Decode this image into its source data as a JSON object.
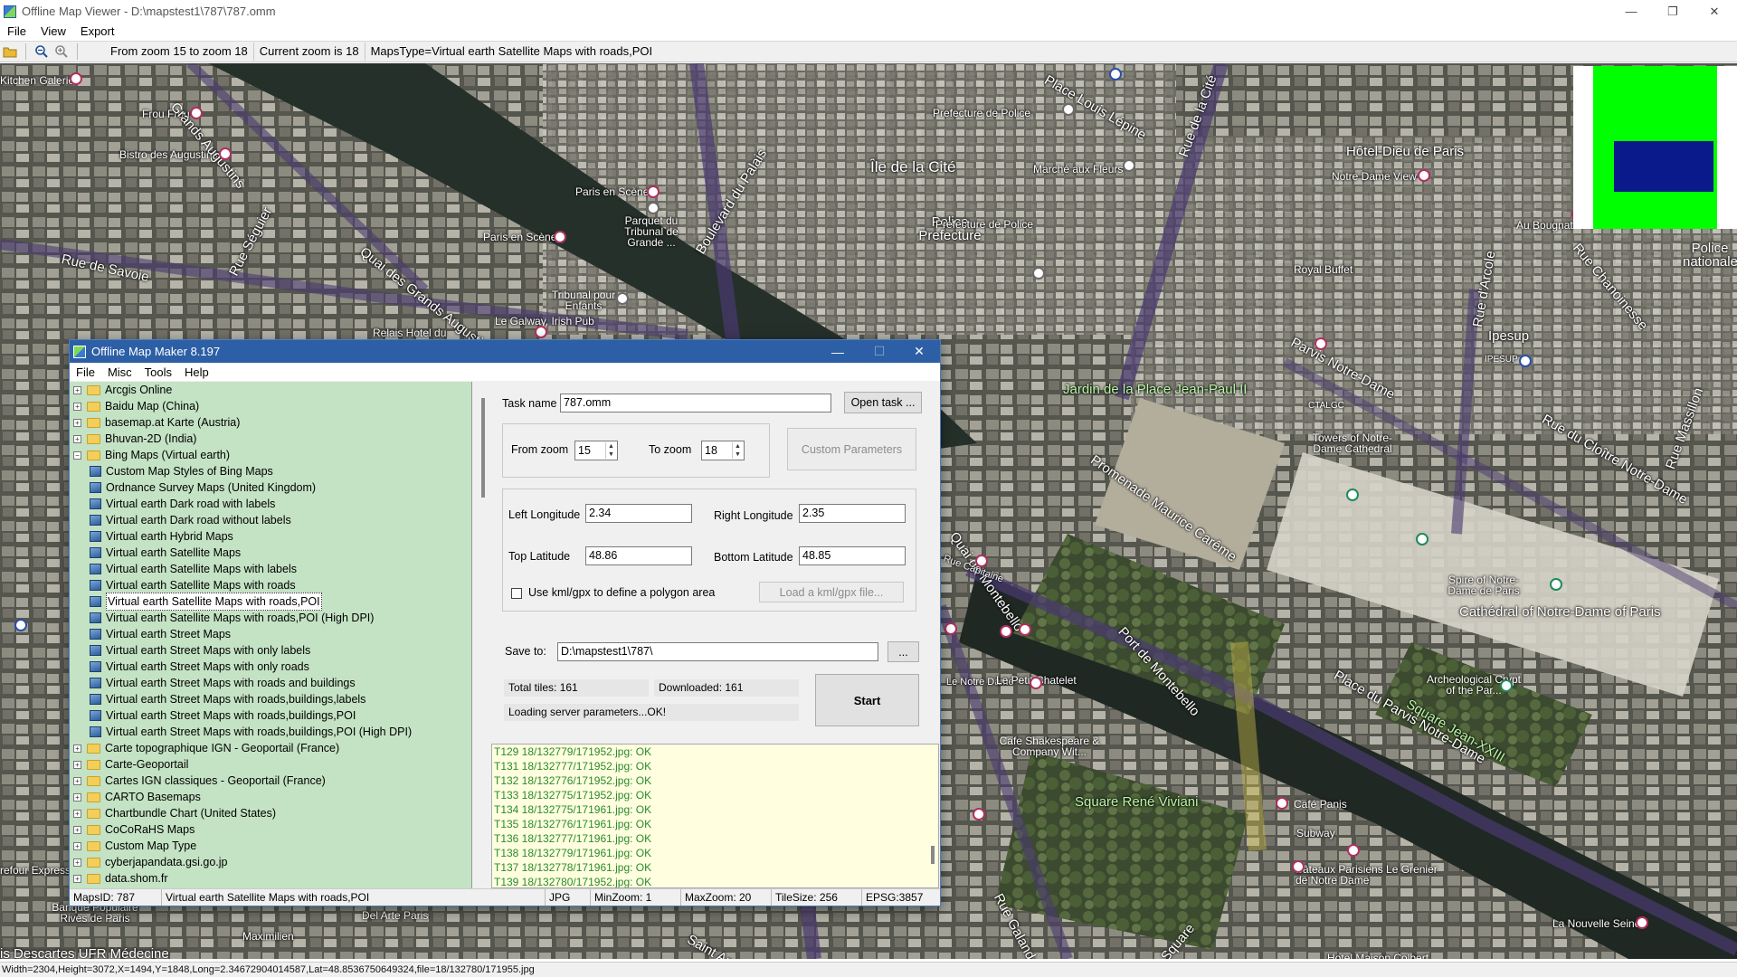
{
  "window": {
    "title": "Offline Map Viewer - D:\\mapstest1\\787\\787.omm",
    "minimize": "—",
    "maximize": "❐",
    "close": "✕"
  },
  "menu": [
    "File",
    "View",
    "Export"
  ],
  "toolbar": {
    "zoom_range": "From zoom 15 to zoom 18",
    "current_zoom": "Current zoom is 18",
    "maps_type": "MapsType=Virtual earth Satellite Maps with roads,POI"
  },
  "map_labels": {
    "grands_augustins": "Quai des Grands Augustins",
    "rue_grands_augustins": "Grands Augustins",
    "ile_de_la_cite": "Île de la Cité",
    "boulevard_du_palais": "Boulevard du Palais",
    "rue_de_la_cite": "Rue de la Cité",
    "hotel_dieu": "Hôtel-Dieu de Paris",
    "notre_dame_view": "Notre Dame View",
    "prefecture_police_1": "Prefecture de Police",
    "marche_aux_fleurs": "Marché aux Fleurs",
    "place_louis_lepine": "Place Louis Lépine",
    "police_prefecture": "Police Prefecture",
    "prefecture_police_2": "Prefecture de Police",
    "paris_en_scene_1": "Paris en Scène",
    "paris_en_scene_2": "Paris en Scène",
    "parquet_tribunal": "Parquet du Tribunal de Grande ...",
    "tribunal_enfants": "Tribunal pour Enfants",
    "le_galway": "Le Galway, Irish Pub",
    "relais_hotel": "Relais Hotel du",
    "rue_de_savoie": "Rue de Savoie",
    "rue_seguier": "Rue Séguier",
    "kitchen_galerie": "Kitchen Galerie",
    "frou_frou": "Frou Frou",
    "bistro_augustins": "Bistro des Augustins",
    "rue_d_arcole": "Rue d'Arcole",
    "au_bougnat": "Au Bougnat",
    "rue_chanoinesse": "Rue Chanoinesse",
    "police_nationale": "Police nationale",
    "royal_buffet": "Royal Buffet",
    "jardin": "Jardin de la Place Jean-Paul II",
    "parvis_notre_dame": "Parvis Notre-Dame",
    "ipesup": "Ipesup",
    "ipesup_small": "IPESUP",
    "rue_cloitre": "Rue du Cloître Notre-Dame",
    "rue_massillon": "Rue Massillon",
    "ctalgc": "CTALGC",
    "towers_notre_dame": "Towers of Notre-Dame Cathedral",
    "spire_notre_dame": "Spire of Notre-Dame de Paris",
    "cathedral": "Cathédral of Notre-Dame of Paris",
    "promenade": "Promenade Maurice Carême",
    "quai_montebello": "Quai de Montebello",
    "port_montebello": "Port de Montebello",
    "place_du_parvis": "Place du Parvis Notre-Dame",
    "square_jean_xxiii": "Square Jean-XXIII",
    "archeological_crypt": "Archeological Crypt of the Par...",
    "le_petit_chatelet": "Le Petit Chatelet",
    "shakespeare": "Cafe Shakespeare & Company Wit...",
    "square_viviani": "Square René Viviani",
    "cafe_panis": "Café Panis",
    "subway": "Subway",
    "bateaux": "Bâteaux Parisiens Le Grenier de Notre Dame",
    "la_nouvelle_seine": "La Nouvelle Seine",
    "hotel_maison_colbert": "Hotel Maison Colbert",
    "descartes": "is Descartes UFR Médecine",
    "banque_populaire": "Banque Populaire Rives de Paris",
    "del_arte": "Del Arte Paris",
    "maximilien": "Maximilien",
    "refour_express": "refour Express",
    "rue_galande": "Rue Galande",
    "square_label": "Square",
    "rue_saint_andre": "Saint André",
    "notre_dame_small": "Le Notre Dame",
    "rue_capitaine": "Rue Capitaine"
  },
  "dialog": {
    "title": "Offline Map Maker 8.197",
    "minimize": "—",
    "maximize": "☐",
    "close": "✕",
    "menu": [
      "File",
      "Misc",
      "Tools",
      "Help"
    ],
    "tree": [
      {
        "label": "Arcgis Online",
        "kind": "folder",
        "expanded": false
      },
      {
        "label": "Baidu Map (China)",
        "kind": "folder",
        "expanded": false
      },
      {
        "label": "basemap.at Karte (Austria)",
        "kind": "folder",
        "expanded": false
      },
      {
        "label": "Bhuvan-2D (India)",
        "kind": "folder",
        "expanded": false
      },
      {
        "label": "Bing Maps (Virtual earth)",
        "kind": "folder",
        "expanded": true
      },
      {
        "label": "Custom Map Styles of Bing Maps",
        "kind": "map"
      },
      {
        "label": "Ordnance Survey Maps (United Kingdom)",
        "kind": "map"
      },
      {
        "label": "Virtual earth Dark road with labels",
        "kind": "map"
      },
      {
        "label": "Virtual earth Dark road without labels",
        "kind": "map"
      },
      {
        "label": "Virtual earth Hybrid Maps",
        "kind": "map"
      },
      {
        "label": "Virtual earth Satellite Maps",
        "kind": "map"
      },
      {
        "label": "Virtual earth Satellite Maps with labels",
        "kind": "map"
      },
      {
        "label": "Virtual earth Satellite Maps with roads",
        "kind": "map"
      },
      {
        "label": "Virtual earth Satellite Maps with roads,POI",
        "kind": "map",
        "selected": true
      },
      {
        "label": "Virtual earth Satellite Maps with roads,POI (High DPI)",
        "kind": "map"
      },
      {
        "label": "Virtual earth Street Maps",
        "kind": "map"
      },
      {
        "label": "Virtual earth Street Maps with only labels",
        "kind": "map"
      },
      {
        "label": "Virtual earth Street Maps with only roads",
        "kind": "map"
      },
      {
        "label": "Virtual earth Street Maps with roads and buildings",
        "kind": "map"
      },
      {
        "label": "Virtual earth Street Maps with roads,buildings,labels",
        "kind": "map"
      },
      {
        "label": "Virtual earth Street Maps with roads,buildings,POI",
        "kind": "map"
      },
      {
        "label": "Virtual earth Street Maps with roads,buildings,POI (High DPI)",
        "kind": "map"
      },
      {
        "label": "Carte topographique IGN - Geoportail (France)",
        "kind": "folder",
        "expanded": false
      },
      {
        "label": "Carte-Geoportail",
        "kind": "folder",
        "expanded": false
      },
      {
        "label": "Cartes IGN classiques - Geoportail (France)",
        "kind": "folder",
        "expanded": false
      },
      {
        "label": "CARTO Basemaps",
        "kind": "folder",
        "expanded": false
      },
      {
        "label": "Chartbundle Chart (United States)",
        "kind": "folder",
        "expanded": false
      },
      {
        "label": "CoCoRaHS Maps",
        "kind": "folder",
        "expanded": false
      },
      {
        "label": "Custom Map Type",
        "kind": "folder",
        "expanded": false
      },
      {
        "label": "cyberjapandata.gsi.go.jp",
        "kind": "folder",
        "expanded": false
      },
      {
        "label": "data.shom.fr",
        "kind": "folder",
        "expanded": false
      }
    ],
    "task_name_label": "Task name",
    "task_name_value": "787.omm",
    "open_task": "Open task ...",
    "from_zoom_label": "From zoom",
    "from_zoom_value": "15",
    "to_zoom_label": "To zoom",
    "to_zoom_value": "18",
    "custom_parameters": "Custom Parameters",
    "left_lon_label": "Left Longitude",
    "left_lon_value": "2.34",
    "right_lon_label": "Right Longitude",
    "right_lon_value": "2.35",
    "top_lat_label": "Top Latitude",
    "top_lat_value": "48.86",
    "bottom_lat_label": "Bottom Latitude",
    "bottom_lat_value": "48.85",
    "kml_label": "Use kml/gpx to define a polygon area",
    "load_kml": "Load a kml/gpx file...",
    "save_to_label": "Save to:",
    "save_to_value": "D:\\mapstest1\\787\\",
    "browse": "...",
    "total_tiles": "Total tiles: 161",
    "downloaded": "Downloaded: 161",
    "loading_status": "Loading server parameters...OK!",
    "start": "Start",
    "log": [
      "T129 18/132779/171952.jpg: OK",
      "T131 18/132777/171952.jpg: OK",
      "T132 18/132776/171952.jpg: OK",
      "T133 18/132775/171952.jpg: OK",
      "T134 18/132775/171961.jpg: OK",
      "T135 18/132776/171961.jpg: OK",
      "T136 18/132777/171961.jpg: OK",
      "T138 18/132779/171961.jpg: OK",
      "T137 18/132778/171961.jpg: OK",
      "T139 18/132780/171952.jpg: OK"
    ],
    "status": {
      "maps_id": "MapsID: 787",
      "maps_name": "Virtual earth Satellite Maps with roads,POI",
      "format": "JPG",
      "min_zoom": "MinZoom: 1",
      "max_zoom": "MaxZoom: 20",
      "tile_size": "TileSize: 256",
      "epsg": "EPSG:3857"
    }
  },
  "statusbar": "Width=2304,Height=3072,X=1494,Y=1848,Long=2.34672904014587,Lat=48.8536750649324,file=18/132780/171955.jpg",
  "colors": {
    "dialog_title": "#2d5fa6",
    "tree_bg": "#c4e2c4",
    "log_bg": "#ffffe0",
    "log_text": "#2b8a2b",
    "overview_green": "#00ff00",
    "overview_blue": "#0a1a8a"
  }
}
